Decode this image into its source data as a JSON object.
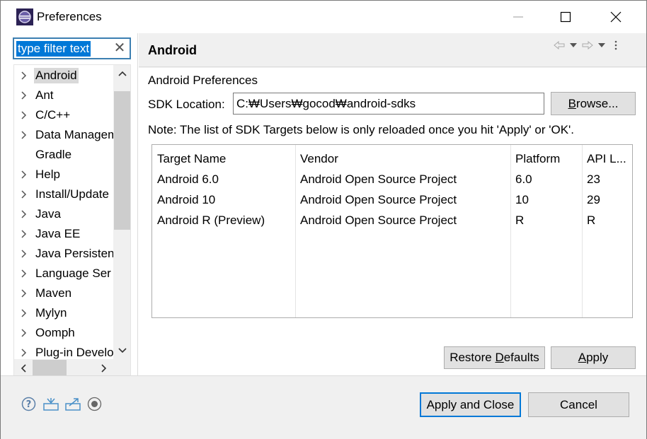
{
  "window": {
    "title": "Preferences"
  },
  "filter": {
    "value": "type filter text"
  },
  "tree": {
    "items": [
      {
        "label": "Android",
        "expandable": true,
        "selected": true
      },
      {
        "label": "Ant",
        "expandable": true
      },
      {
        "label": "C/C++",
        "expandable": true
      },
      {
        "label": "Data Managem",
        "expandable": true
      },
      {
        "label": "Gradle",
        "expandable": false
      },
      {
        "label": "Help",
        "expandable": true
      },
      {
        "label": "Install/Update",
        "expandable": true
      },
      {
        "label": "Java",
        "expandable": true
      },
      {
        "label": "Java EE",
        "expandable": true
      },
      {
        "label": "Java Persisten",
        "expandable": true
      },
      {
        "label": "Language Ser",
        "expandable": true
      },
      {
        "label": "Maven",
        "expandable": true
      },
      {
        "label": "Mylyn",
        "expandable": true
      },
      {
        "label": "Oomph",
        "expandable": true
      },
      {
        "label": "Plug-in Develo",
        "expandable": true
      }
    ]
  },
  "page": {
    "title": "Android",
    "section_title": "Android Preferences",
    "sdk_label": "SDK Location:",
    "sdk_value": "C:₩Users₩gocod₩android-sdks",
    "browse_label_pre": "",
    "browse_label_u": "B",
    "browse_label_post": "rowse...",
    "note": "Note: The list of SDK Targets below is only reloaded once you hit 'Apply' or 'OK'.",
    "table": {
      "headers": [
        "Target Name",
        "Vendor",
        "Platform",
        "API L..."
      ],
      "rows": [
        [
          "Android 6.0",
          "Android Open Source Project",
          "6.0",
          "23"
        ],
        [
          "Android 10",
          "Android Open Source Project",
          "10",
          "29"
        ],
        [
          "Android R (Preview)",
          "Android Open Source Project",
          "R",
          "R"
        ]
      ]
    },
    "restore_pre": "Restore ",
    "restore_u": "D",
    "restore_post": "efaults",
    "apply_pre": "",
    "apply_u": "A",
    "apply_post": "pply"
  },
  "footer": {
    "apply_close_label": "Apply and Close",
    "cancel_label": "Cancel",
    "icons": [
      "help-icon",
      "import-icon",
      "export-icon",
      "record-icon"
    ]
  },
  "colors": {
    "accent": "#0078d7",
    "selection": "#d9d9d9",
    "panel": "#f0f0f0"
  }
}
